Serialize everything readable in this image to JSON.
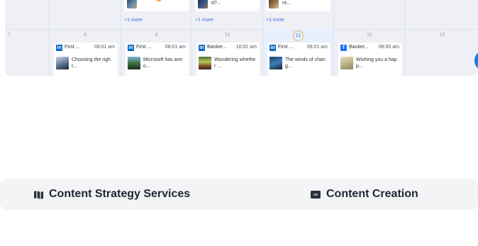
{
  "calendar": {
    "top_row": [
      {
        "day": "",
        "more": "",
        "caption": ""
      },
      {
        "day": "",
        "more": "",
        "caption": ""
      },
      {
        "day": "",
        "more": "+1 more",
        "caption": ""
      },
      {
        "day": "",
        "more": "+1 more",
        "caption": "d?..."
      },
      {
        "day": "",
        "more": "+1 more",
        "caption": "re..."
      },
      {
        "day": "",
        "more": "",
        "caption": ""
      }
    ],
    "week": [
      {
        "day": "7"
      },
      {
        "day": "8",
        "post": {
          "network": "linkedin",
          "network_glyph": "in",
          "account": "First ...",
          "time": "08:01 am",
          "caption": "Choosing the righ t..."
        }
      },
      {
        "day": "9",
        "post": {
          "network": "linkedin",
          "network_glyph": "in",
          "account": "First ...",
          "time": "08:01 am",
          "caption": "Microsoft has ann o..."
        }
      },
      {
        "day": "10",
        "post": {
          "network": "linkedin",
          "network_glyph": "in",
          "account": "Banker...",
          "time": "10:02 am",
          "caption": "Wondering whethe r ..."
        }
      },
      {
        "day": "11",
        "today": true,
        "post": {
          "network": "linkedin",
          "network_glyph": "in",
          "account": "First ...",
          "time": "08:01 am",
          "caption": "The winds of chan g..."
        }
      },
      {
        "day": "12",
        "post": {
          "network": "facebook",
          "network_glyph": "f",
          "account": "Banker...",
          "time": "08:00 am",
          "caption": "Wishing you a hap p..."
        }
      },
      {
        "day": "13"
      }
    ],
    "colors": {
      "linkedin": "#0a66c2",
      "facebook": "#1877f2",
      "today": "#e7eefc",
      "more_link": "#4a6fd8"
    }
  },
  "services": [
    {
      "icon": "map-icon",
      "label": "Content Strategy Services"
    },
    {
      "icon": "ai-chip-icon",
      "label": "Content Creation"
    }
  ]
}
